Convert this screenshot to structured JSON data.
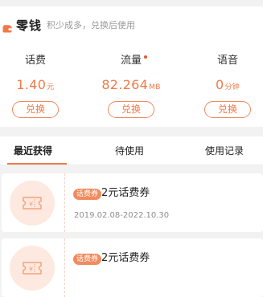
{
  "wallet": {
    "title": "零钱",
    "subtitle": "积少成多，兑换后使用",
    "icon": "wallet-icon",
    "accent": "#f07a47"
  },
  "balances": [
    {
      "label": "话费",
      "value": "1.40",
      "unit": "元",
      "button": "兑换",
      "has_dot": false
    },
    {
      "label": "流量",
      "value": "82.264",
      "unit": "MB",
      "button": "兑换",
      "has_dot": true
    },
    {
      "label": "语音",
      "value": "0",
      "unit": "分钟",
      "button": "兑换",
      "has_dot": false
    }
  ],
  "tabs": [
    {
      "label": "最近获得",
      "active": true
    },
    {
      "label": "待使用",
      "active": false
    },
    {
      "label": "使用记录",
      "active": false
    }
  ],
  "coupons": [
    {
      "badge": "话费券",
      "title": "2元话费券",
      "date": "2019.02.08-2022.10.30",
      "icon": "ticket-yuan-icon"
    },
    {
      "badge": "话费券",
      "title": "2元话费券",
      "date": "",
      "icon": "ticket-yuan-icon"
    }
  ]
}
